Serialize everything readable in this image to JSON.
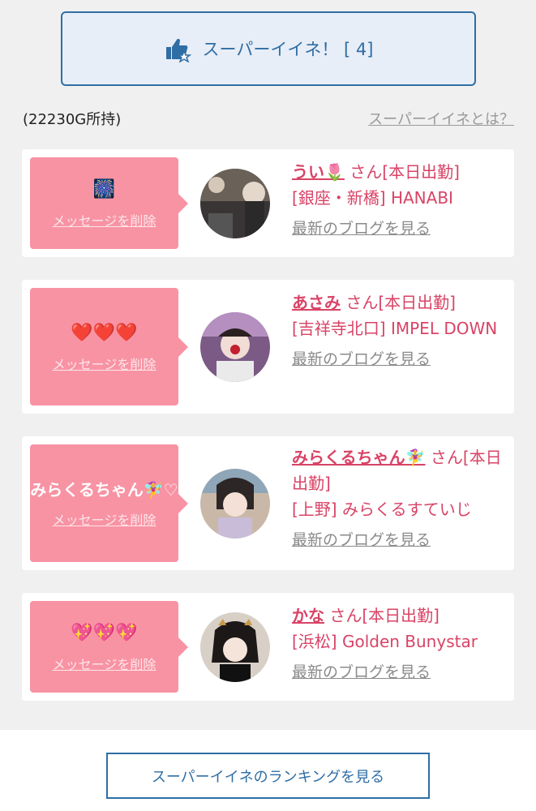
{
  "header": {
    "super_button_label": "スーパーイイネ！ [ 4]",
    "owned_text": "(22230G所持)",
    "about_link": "スーパーイイネとは？"
  },
  "cards": [
    {
      "message": "🎆",
      "delete_label": "メッセージを削除",
      "name": "うい🌷",
      "suffix": " さん[本日出勤]",
      "shop": "[銀座・新橋] HANABI",
      "blog_link": "最新のブログを見る"
    },
    {
      "message": "❤️❤️❤️",
      "delete_label": "メッセージを削除",
      "name": "あさみ",
      "suffix": " さん[本日出勤]",
      "shop": "[吉祥寺北口] IMPEL DOWN",
      "blog_link": "最新のブログを見る"
    },
    {
      "message": "みらくるちゃん🧚‍♀️♡",
      "delete_label": "メッセージを削除",
      "name": "みらくるちゃん🧚‍♀️",
      "suffix": " さん[本日出勤]",
      "shop": "[上野] みらくるすていじ",
      "blog_link": "最新のブログを見る"
    },
    {
      "message": "💖💖💖",
      "delete_label": "メッセージを削除",
      "name": "かな",
      "suffix": " さん[本日出勤]",
      "shop": "[浜松] Golden Bunystar",
      "blog_link": "最新のブログを見る"
    }
  ],
  "footer": {
    "ranking_button_label": "スーパーイイネのランキングを見る"
  },
  "colors": {
    "accent_blue": "#2f6ea4",
    "pink_bubble": "#f893a4",
    "pink_text": "#d94366"
  }
}
